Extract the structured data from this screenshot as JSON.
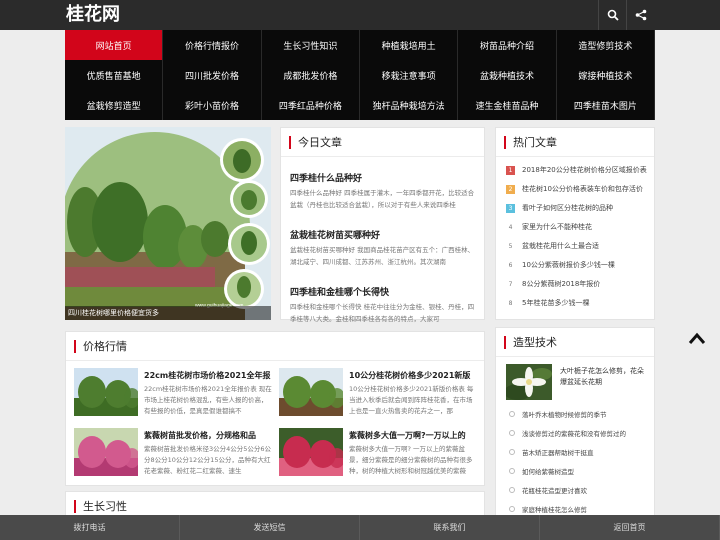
{
  "site": {
    "logo": "桂花网"
  },
  "nav": [
    "网站首页",
    "价格行情报价",
    "生长习性知识",
    "种植栽培用土",
    "树苗品种介绍",
    "造型修剪技术",
    "优质售苗基地",
    "四川批发价格",
    "成都批发价格",
    "移栽注意事项",
    "盆栽种植技术",
    "嫁接种植技术",
    "盆栽修剪造型",
    "彩叶小苗价格",
    "四季红品种价格",
    "独杆品种栽培方法",
    "速生金桂苗品种",
    "四季桂苗木图片"
  ],
  "hero": {
    "caption": "四川桂花树哪里价格便宜货多",
    "watermark": "www.guihuajiage.com"
  },
  "today": {
    "title": "今日文章",
    "articles": [
      {
        "title": "四季桂什么品种好",
        "desc": "四季桂什么品种好 四季桂属于灌木，一年四季都开花，比较适合盆栽（丹桂也比较适合盆栽），所以对于有些人来说四季桂"
      },
      {
        "title": "盆栽桂花树苗买哪种好",
        "desc": "盆栽桂花树苗买哪种好 我国商品桂花苗产区有五个：广西桂林、湖北咸宁、四川成都、江苏苏州、浙江杭州。其次湖南"
      },
      {
        "title": "四季桂和金桂哪个长得快",
        "desc": "四季桂和金桂哪个长得快 桂花中往往分为金桂、银桂、丹桂，四季桂等八大类。金桂和四季桂各有各的特点，大家可"
      }
    ]
  },
  "hot": {
    "title": "热门文章",
    "items": [
      "2018年20公分桂花树价格分区域报价表",
      "桂花树10公分价格表装车价和包存活价",
      "看叶子如何区分桂花树的品种",
      "家里为什么不能种桂花",
      "盆栽桂花用什么土最合适",
      "10公分紫薇树报价多少钱一棵",
      "8公分紫薇树2018年报价",
      "5年桂花苗多少钱一棵"
    ]
  },
  "price": {
    "title": "价格行情",
    "items": [
      {
        "title": "22cm桂花树市场价格2021全年报",
        "desc": "22cm桂花树市场价格2021全年报价表 现在市场上桂花树价格混乱，有些人报的价高，有些报的价低，是真是假谁都搞不"
      },
      {
        "title": "10公分桂花树价格多少2021新版",
        "desc": "10公分桂花树价格多少2021新版价格表 每当进入秋季后就会闻到阵阵桂花香，在市场上也是一直火热售卖的花卉之一，那"
      },
      {
        "title": "紫薇树苗批发价格，分规格和品",
        "desc": "紫薇树苗批发价格米径3公分4公分5公分6公分8公分10公分12公分15公分，品种有大红花老紫薇、粉红花二红紫薇、速生"
      },
      {
        "title": "紫薇树多大值一万啊?一万以上的",
        "desc": "紫薇树多大值一万啊? 一万以上的紫薇盆景，细分紫薇是的细分紫薇树的品种有很多种，树的种植大树形和树冠越优美的紫薇"
      }
    ]
  },
  "tech": {
    "title": "造型技术",
    "feature": "大叶栀子花怎么修剪，花朵爆盆延长花期",
    "items": [
      "落叶乔木植物时候修剪的季节",
      "浅谈修剪过的紫薇花和没有修剪过的",
      "苗木矫正器帮助树干挺直",
      "如何给紫薇树造型",
      "花瓶桂花造型更讨喜欢",
      "家庭种植桂花怎么修剪"
    ]
  },
  "grow": {
    "title": "生长习性"
  },
  "bottom": [
    "拨打电话",
    "发送短信",
    "联系我们",
    "返回首页"
  ],
  "icons": {
    "search": "search-icon",
    "share": "share-icon",
    "top": "arrow-up-icon"
  }
}
